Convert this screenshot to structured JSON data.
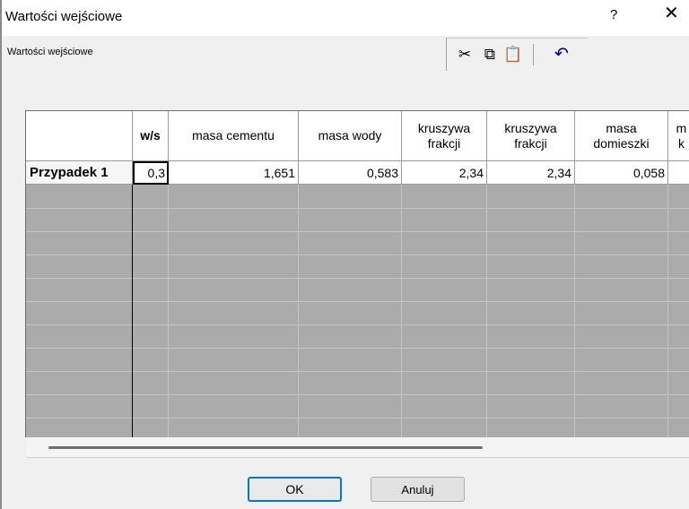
{
  "window": {
    "title": "Wartości wejściowe",
    "help_label": "?",
    "close_label": "✕"
  },
  "group_label": "Wartości wejściowe",
  "toolbar": {
    "cut_icon": "scissors-icon",
    "copy_icon": "copy-icon",
    "paste_icon": "paste-icon",
    "undo_icon": "undo-icon"
  },
  "grid": {
    "columns": [
      {
        "label": "",
        "bold": false
      },
      {
        "label": "w/s",
        "bold": true
      },
      {
        "label": "masa cementu",
        "bold": false
      },
      {
        "label": "masa wody",
        "bold": false
      },
      {
        "label": "kruszywa frakcji",
        "bold": false
      },
      {
        "label": "kruszywa frakcji",
        "bold": false
      },
      {
        "label": "masa domieszki",
        "bold": false
      },
      {
        "label": "m k",
        "bold": false
      }
    ],
    "rows": [
      {
        "header": "Przypadek 1",
        "values": [
          "0,3",
          "1,651",
          "0,583",
          "2,34",
          "2,34",
          "0,058",
          ""
        ]
      }
    ]
  },
  "buttons": {
    "ok": "OK",
    "cancel": "Anuluj"
  }
}
